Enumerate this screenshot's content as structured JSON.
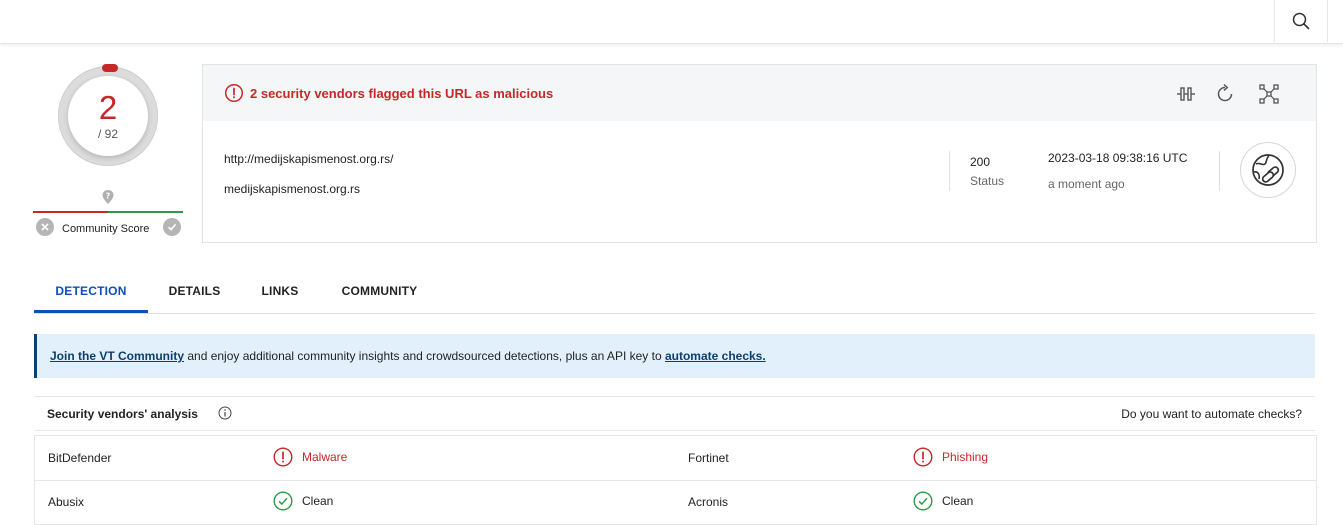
{
  "header": {
    "search_icon": "search-icon"
  },
  "score": {
    "detections": "2",
    "total": "/ 92",
    "community_label": "Community Score"
  },
  "summary": {
    "alert": "2 security vendors flagged this URL as malicious",
    "url": "http://medijskapismenost.org.rs/",
    "domain": "medijskapismenost.org.rs",
    "status_code": "200",
    "status_label": "Status",
    "date": "2023-03-18 09:38:16 UTC",
    "ago": "a moment ago",
    "tools": [
      "compare-icon",
      "reanalyze-icon",
      "graph-icon"
    ]
  },
  "tabs": [
    {
      "label": "DETECTION",
      "active": true
    },
    {
      "label": "DETAILS",
      "active": false
    },
    {
      "label": "LINKS",
      "active": false
    },
    {
      "label": "COMMUNITY",
      "active": false
    }
  ],
  "banner": {
    "link1": "Join the VT Community",
    "middle": " and enjoy additional community insights and crowdsourced detections, plus an API key to ",
    "link2": "automate checks."
  },
  "vendors": {
    "title": "Security vendors' analysis",
    "automate": "Do you want to automate checks?",
    "rows": [
      [
        {
          "name": "BitDefender",
          "result": "Malware"
        },
        {
          "name": "Fortinet",
          "result": "Phishing"
        }
      ],
      [
        {
          "name": "Abusix",
          "result": "Clean"
        },
        {
          "name": "Acronis",
          "result": "Clean"
        }
      ]
    ]
  },
  "colors": {
    "malicious": "#c62828",
    "clean": "#2e9a4a",
    "accent": "#0b4fb8",
    "banner_bg": "#e1f0fa"
  }
}
